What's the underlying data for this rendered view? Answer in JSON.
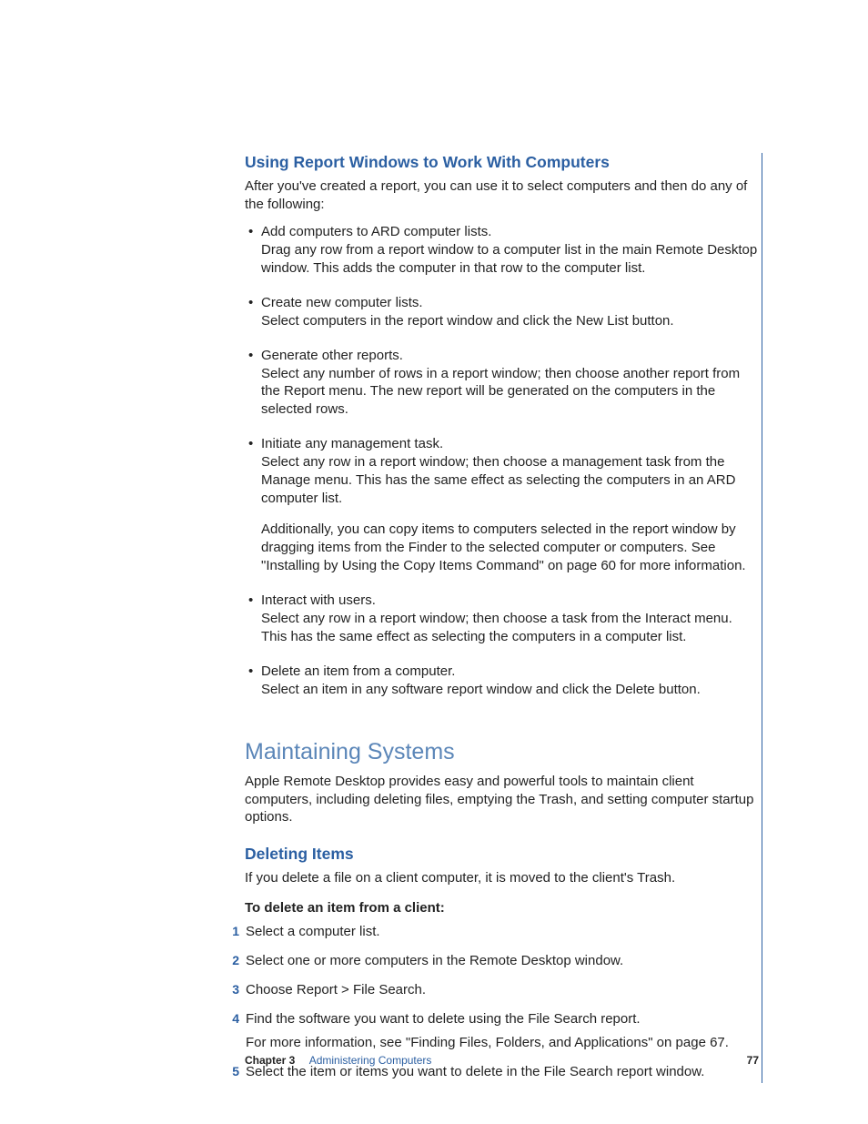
{
  "section1": {
    "heading": "Using Report Windows to Work With Computers",
    "intro": "After you've created a report, you can use it to select computers and then do any of the following:",
    "bullets": [
      {
        "lead": "Add computers to ARD computer lists.",
        "body": "Drag any row from a report window to a computer list in the main Remote Desktop window. This adds the computer in that row to the computer list."
      },
      {
        "lead": "Create new computer lists.",
        "body": "Select computers in the report window and click the New List button."
      },
      {
        "lead": "Generate other reports.",
        "body": "Select any number of rows in a report window; then choose another report from the Report menu. The new report will be generated on the computers in the selected rows."
      },
      {
        "lead": "Initiate any management task.",
        "body": "Select any row in a report window; then choose a management task from the Manage menu. This has the same effect as selecting the computers in an ARD computer list.",
        "extra": "Additionally, you can copy items to computers selected in the report window by dragging items from the Finder to the selected computer or computers. See \"Installing by Using the Copy Items Command\" on page 60 for more information."
      },
      {
        "lead": "Interact with users.",
        "body": "Select any row in a report window; then choose a task from the Interact menu. This has the same effect as selecting the computers in a computer list."
      },
      {
        "lead": "Delete an item from a computer.",
        "body": "Select an item in any software report window and click the Delete button."
      }
    ]
  },
  "section2": {
    "heading": "Maintaining Systems",
    "intro": "Apple Remote Desktop provides easy and powerful tools to maintain client computers, including deleting files, emptying the Trash, and setting computer startup options.",
    "sub": {
      "heading": "Deleting Items",
      "intro": "If you delete a file on a client computer, it is moved to the client's Trash.",
      "procTitle": "To delete an item from a client:",
      "steps": [
        {
          "n": "1",
          "t": "Select a computer list."
        },
        {
          "n": "2",
          "t": "Select one or more computers in the Remote Desktop window."
        },
        {
          "n": "3",
          "t": "Choose Report > File Search."
        },
        {
          "n": "4",
          "t": "Find the software you want to delete using the File Search report.",
          "sub": "For more information, see \"Finding Files, Folders, and Applications\" on page 67."
        },
        {
          "n": "5",
          "t": "Select the item or items you want to delete in the File Search report window."
        }
      ]
    }
  },
  "footer": {
    "chapter": "Chapter 3",
    "title": "Administering Computers",
    "page": "77"
  }
}
